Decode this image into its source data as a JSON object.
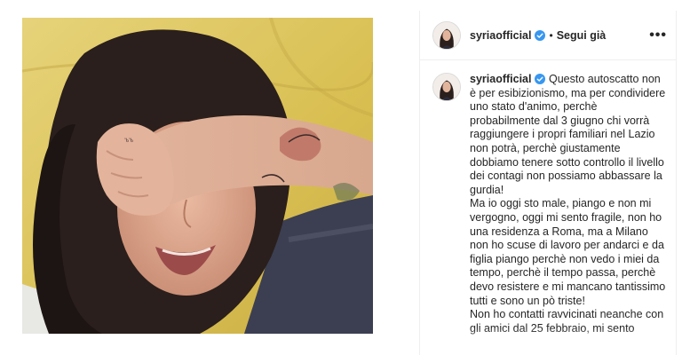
{
  "post": {
    "username": "syriaofficial",
    "separator": "•",
    "follow_label": "Segui già",
    "more_label": "•••",
    "caption": {
      "para1": "Questo autoscatto non è per esibizionismo, ma per condividere uno stato d'animo, perchè probabilmente dal 3 giugno chi vorrà raggiungere i propri familiari nel Lazio non potrà, perchè giustamente dobbiamo tenere sotto controllo il livello dei contagi non possiamo abbassare la gurdia!",
      "para2": "Ma io oggi sto male, piango e non mi vergogno, oggi mi sento fragile, non ho una residenza a Roma, ma a Milano non ho scuse di lavoro per andarci e da figlia piango perchè non vedo i miei da tempo, perchè il tempo passa, perchè devo resistere e mi mancano tantissimo tutti e sono un pò triste!",
      "para3": "Non ho contatti ravvicinati neanche con gli amici dal 25 febbraio, mi sento"
    }
  },
  "colors": {
    "verified": "#3897f0",
    "text": "#262626",
    "pillow": "#d9c25a"
  },
  "icons": {
    "verified": "verified-badge-icon",
    "more": "more-options-icon"
  }
}
